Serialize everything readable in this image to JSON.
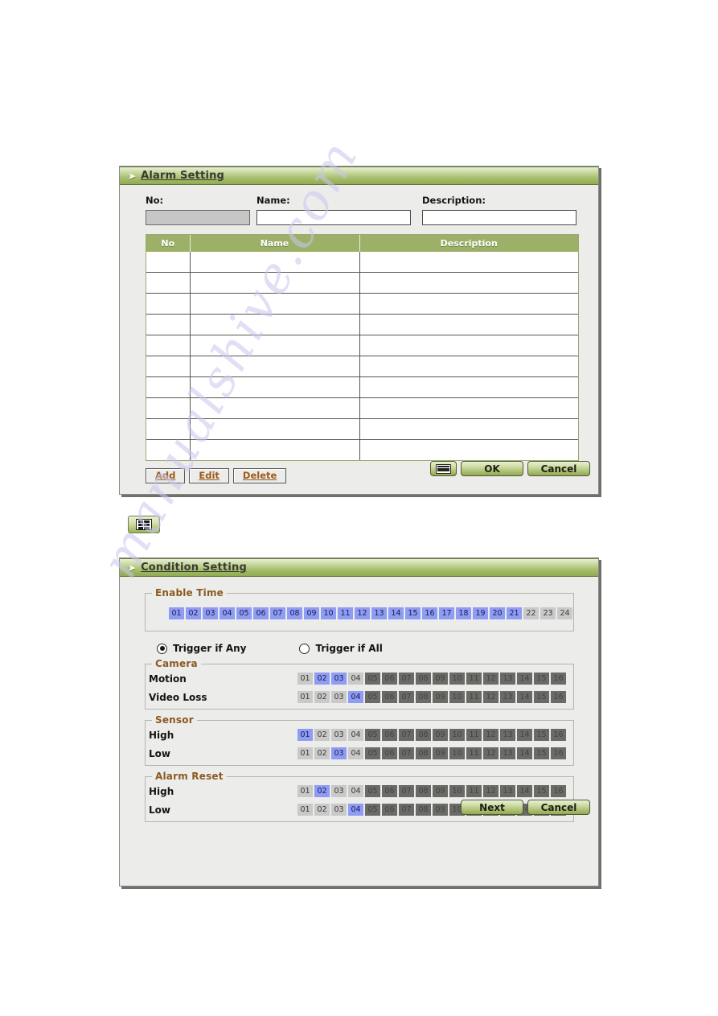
{
  "watermark": {
    "text": "manualshive.com"
  },
  "alarm_dialog": {
    "title": "Alarm Setting",
    "title_arrow": "➤",
    "fields": [
      {
        "label": "No:",
        "value": "",
        "placeholder": "",
        "disabled": true
      },
      {
        "label": "Name:",
        "value": "",
        "placeholder": "",
        "disabled": false
      },
      {
        "label": "Description:",
        "value": "",
        "placeholder": "",
        "disabled": false
      }
    ],
    "table": {
      "columns": [
        "No",
        "Name",
        "Description"
      ],
      "rows": [
        [
          "",
          "",
          ""
        ],
        [
          "",
          "",
          ""
        ],
        [
          "",
          "",
          ""
        ],
        [
          "",
          "",
          ""
        ],
        [
          "",
          "",
          ""
        ],
        [
          "",
          "",
          ""
        ],
        [
          "",
          "",
          ""
        ],
        [
          "",
          "",
          ""
        ],
        [
          "",
          "",
          ""
        ],
        [
          "",
          "",
          ""
        ]
      ]
    },
    "edit_buttons": [
      {
        "label": "Add"
      },
      {
        "label": "Edit"
      },
      {
        "label": "Delete"
      }
    ],
    "action_buttons": {
      "keyboard_icon": "keyboard-icon",
      "ok_label": "OK",
      "cancel_label": "Cancel"
    }
  },
  "list_icon_button": {
    "icon": "list-view-icon"
  },
  "condition_dialog": {
    "title": "Condition Setting",
    "title_arrow": "➤",
    "enable_time": {
      "legend": "Enable Time",
      "cells": [
        {
          "label": "01",
          "state": "on"
        },
        {
          "label": "02",
          "state": "on"
        },
        {
          "label": "03",
          "state": "on"
        },
        {
          "label": "04",
          "state": "on"
        },
        {
          "label": "05",
          "state": "on"
        },
        {
          "label": "06",
          "state": "on"
        },
        {
          "label": "07",
          "state": "on"
        },
        {
          "label": "08",
          "state": "on"
        },
        {
          "label": "09",
          "state": "on"
        },
        {
          "label": "10",
          "state": "on"
        },
        {
          "label": "11",
          "state": "on"
        },
        {
          "label": "12",
          "state": "on"
        },
        {
          "label": "13",
          "state": "on"
        },
        {
          "label": "14",
          "state": "on"
        },
        {
          "label": "15",
          "state": "on"
        },
        {
          "label": "16",
          "state": "on"
        },
        {
          "label": "17",
          "state": "on"
        },
        {
          "label": "18",
          "state": "on"
        },
        {
          "label": "19",
          "state": "on"
        },
        {
          "label": "20",
          "state": "on"
        },
        {
          "label": "21",
          "state": "on"
        },
        {
          "label": "22",
          "state": "off"
        },
        {
          "label": "23",
          "state": "off"
        },
        {
          "label": "24",
          "state": "off"
        }
      ]
    },
    "trigger": {
      "any_label": "Trigger if Any",
      "all_label": "Trigger if All",
      "selected": "any"
    },
    "groups": [
      {
        "legend": "Camera",
        "rows": [
          {
            "label": "Motion",
            "cells": [
              {
                "label": "01",
                "state": "off"
              },
              {
                "label": "02",
                "state": "on"
              },
              {
                "label": "03",
                "state": "on"
              },
              {
                "label": "04",
                "state": "off"
              },
              {
                "label": "05",
                "state": "dis"
              },
              {
                "label": "06",
                "state": "dis"
              },
              {
                "label": "07",
                "state": "dis"
              },
              {
                "label": "08",
                "state": "dis"
              },
              {
                "label": "09",
                "state": "dis"
              },
              {
                "label": "10",
                "state": "dis"
              },
              {
                "label": "11",
                "state": "dis"
              },
              {
                "label": "12",
                "state": "dis"
              },
              {
                "label": "13",
                "state": "dis"
              },
              {
                "label": "14",
                "state": "dis"
              },
              {
                "label": "15",
                "state": "dis"
              },
              {
                "label": "16",
                "state": "dis"
              }
            ]
          },
          {
            "label": "Video Loss",
            "cells": [
              {
                "label": "01",
                "state": "off"
              },
              {
                "label": "02",
                "state": "off"
              },
              {
                "label": "03",
                "state": "off"
              },
              {
                "label": "04",
                "state": "on"
              },
              {
                "label": "05",
                "state": "dis"
              },
              {
                "label": "06",
                "state": "dis"
              },
              {
                "label": "07",
                "state": "dis"
              },
              {
                "label": "08",
                "state": "dis"
              },
              {
                "label": "09",
                "state": "dis"
              },
              {
                "label": "10",
                "state": "dis"
              },
              {
                "label": "11",
                "state": "dis"
              },
              {
                "label": "12",
                "state": "dis"
              },
              {
                "label": "13",
                "state": "dis"
              },
              {
                "label": "14",
                "state": "dis"
              },
              {
                "label": "15",
                "state": "dis"
              },
              {
                "label": "16",
                "state": "dis"
              }
            ]
          }
        ]
      },
      {
        "legend": "Sensor",
        "rows": [
          {
            "label": "High",
            "cells": [
              {
                "label": "01",
                "state": "on"
              },
              {
                "label": "02",
                "state": "off"
              },
              {
                "label": "03",
                "state": "off"
              },
              {
                "label": "04",
                "state": "off"
              },
              {
                "label": "05",
                "state": "dis"
              },
              {
                "label": "06",
                "state": "dis"
              },
              {
                "label": "07",
                "state": "dis"
              },
              {
                "label": "08",
                "state": "dis"
              },
              {
                "label": "09",
                "state": "dis"
              },
              {
                "label": "10",
                "state": "dis"
              },
              {
                "label": "11",
                "state": "dis"
              },
              {
                "label": "12",
                "state": "dis"
              },
              {
                "label": "13",
                "state": "dis"
              },
              {
                "label": "14",
                "state": "dis"
              },
              {
                "label": "15",
                "state": "dis"
              },
              {
                "label": "16",
                "state": "dis"
              }
            ]
          },
          {
            "label": "Low",
            "cells": [
              {
                "label": "01",
                "state": "off"
              },
              {
                "label": "02",
                "state": "off"
              },
              {
                "label": "03",
                "state": "on"
              },
              {
                "label": "04",
                "state": "off"
              },
              {
                "label": "05",
                "state": "dis"
              },
              {
                "label": "06",
                "state": "dis"
              },
              {
                "label": "07",
                "state": "dis"
              },
              {
                "label": "08",
                "state": "dis"
              },
              {
                "label": "09",
                "state": "dis"
              },
              {
                "label": "10",
                "state": "dis"
              },
              {
                "label": "11",
                "state": "dis"
              },
              {
                "label": "12",
                "state": "dis"
              },
              {
                "label": "13",
                "state": "dis"
              },
              {
                "label": "14",
                "state": "dis"
              },
              {
                "label": "15",
                "state": "dis"
              },
              {
                "label": "16",
                "state": "dis"
              }
            ]
          }
        ]
      },
      {
        "legend": "Alarm Reset",
        "rows": [
          {
            "label": "High",
            "cells": [
              {
                "label": "01",
                "state": "off"
              },
              {
                "label": "02",
                "state": "on"
              },
              {
                "label": "03",
                "state": "off"
              },
              {
                "label": "04",
                "state": "off"
              },
              {
                "label": "05",
                "state": "dis"
              },
              {
                "label": "06",
                "state": "dis"
              },
              {
                "label": "07",
                "state": "dis"
              },
              {
                "label": "08",
                "state": "dis"
              },
              {
                "label": "09",
                "state": "dis"
              },
              {
                "label": "10",
                "state": "dis"
              },
              {
                "label": "11",
                "state": "dis"
              },
              {
                "label": "12",
                "state": "dis"
              },
              {
                "label": "13",
                "state": "dis"
              },
              {
                "label": "14",
                "state": "dis"
              },
              {
                "label": "15",
                "state": "dis"
              },
              {
                "label": "16",
                "state": "dis"
              }
            ]
          },
          {
            "label": "Low",
            "cells": [
              {
                "label": "01",
                "state": "off"
              },
              {
                "label": "02",
                "state": "off"
              },
              {
                "label": "03",
                "state": "off"
              },
              {
                "label": "04",
                "state": "on"
              },
              {
                "label": "05",
                "state": "dis"
              },
              {
                "label": "06",
                "state": "dis"
              },
              {
                "label": "07",
                "state": "dis"
              },
              {
                "label": "08",
                "state": "dis"
              },
              {
                "label": "09",
                "state": "dis"
              },
              {
                "label": "10",
                "state": "dis"
              },
              {
                "label": "11",
                "state": "dis"
              },
              {
                "label": "12",
                "state": "dis"
              },
              {
                "label": "13",
                "state": "dis"
              },
              {
                "label": "14",
                "state": "dis"
              },
              {
                "label": "15",
                "state": "dis"
              },
              {
                "label": "16",
                "state": "dis"
              }
            ]
          }
        ]
      }
    ],
    "action_buttons": {
      "next_label": "Next",
      "cancel_label": "Cancel"
    }
  },
  "colors": {
    "title_green": "#a9bf6e",
    "header_green": "#9cb167",
    "cell_on_blue": "#8f9cf4",
    "cell_off_gray": "#c9c9c9",
    "cell_disabled_gray": "#6a6a66",
    "legend_brown": "#8a5a20",
    "flat_button_text": "#9c5a18",
    "dialog_bg": "#ececeb"
  }
}
